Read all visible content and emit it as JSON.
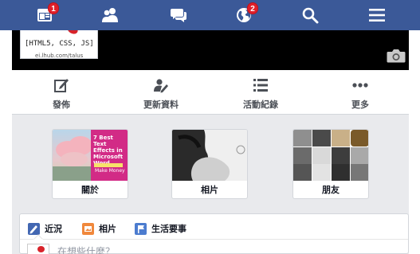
{
  "topnav": {
    "items": [
      {
        "name": "news-feed",
        "icon": "newsfeed-icon",
        "badge": "1"
      },
      {
        "name": "friend-requests",
        "icon": "friends-icon",
        "badge": ""
      },
      {
        "name": "messages",
        "icon": "messages-icon",
        "badge": ""
      },
      {
        "name": "notifications",
        "icon": "globe-icon",
        "badge": "2"
      },
      {
        "name": "search",
        "icon": "search-icon",
        "badge": ""
      },
      {
        "name": "menu",
        "icon": "menu-icon",
        "badge": ""
      }
    ],
    "bar_color": "#3b5998",
    "badge_color": "#e0202a"
  },
  "cover": {
    "profile_text": "[HTML5, CSS, JS]",
    "profile_subtext": "ei.lhub.com/talus",
    "camera_icon": "camera-icon"
  },
  "actions": [
    {
      "label": "發佈",
      "icon": "edit-icon"
    },
    {
      "label": "更新資料",
      "icon": "update-info-icon"
    },
    {
      "label": "活動紀錄",
      "icon": "activity-log-icon"
    },
    {
      "label": "更多",
      "icon": "more-icon"
    }
  ],
  "tiles": {
    "about": {
      "label": "關於",
      "book_title": "7 Best Text Effects in Microsoft Word",
      "book_note": "Make Money"
    },
    "photos": {
      "label": "相片"
    },
    "friends": {
      "label": "朋友"
    }
  },
  "timeline": {
    "tabs": [
      {
        "label": "近況",
        "icon": "pencil-icon",
        "color": "#4267b2"
      },
      {
        "label": "相片",
        "icon": "photo-icon",
        "color": "#f0883c"
      },
      {
        "label": "生活要事",
        "icon": "flag-icon",
        "color": "#4c7ccf"
      }
    ],
    "composer_placeholder": "在想些什麼？"
  }
}
